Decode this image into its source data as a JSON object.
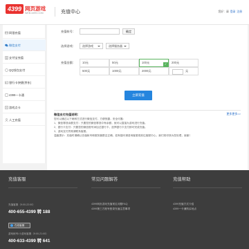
{
  "header": {
    "logo_number": "4399",
    "logo_text": "网页游戏",
    "logo_sub": "WEB.4399.COM",
    "page_title": "充值中心",
    "greeting": "您好：请",
    "login_link": "登录",
    "register_link": "注册"
  },
  "sidebar": {
    "items": [
      {
        "label": "网银充值"
      },
      {
        "label": "微信支付"
      },
      {
        "label": "支付宝充值"
      },
      {
        "label": "QQ钱包支付"
      },
      {
        "label": "银行卡快捷(京东)"
      },
      {
        "label": "4399一卡通"
      },
      {
        "label": "游戏点卡"
      },
      {
        "label": "人工充值"
      }
    ]
  },
  "form": {
    "account_label": "充值帐号：",
    "confirm_button": "确定",
    "game_label": "选择游戏：",
    "game_select": "选择游戏",
    "server_select": "选择服务器",
    "amount_label": "充值金额：",
    "amounts": [
      "10元",
      "50元",
      "100元",
      "200元",
      "500元",
      "1000元",
      "2000元"
    ],
    "selected_amount": "100元",
    "custom_unit": "元",
    "recharge_button": "立即充值"
  },
  "notice": {
    "title": "微信支付充值说明：",
    "more": "更多更多>>",
    "lines": [
      "您可以通过以下两种方式进行微信支付，方便快捷，安全可靠：",
      "1、微信零钱余额支付：只要您的微信零钱中有余额，就可以直接为游戏进行充值。",
      "2、银行卡支付：只要您的微信账号添加过银行卡，选择银行卡支付即可完成充值。",
      "3、游戏支付异常请联系客服。",
      "温馨提示：充值时请确认充值帐号和服务器是否正确，若有疑问请咨询客服或前往客服中心，我们将尽快为您处理，谢谢！"
    ]
  },
  "footer": {
    "service": {
      "title": "充值客服",
      "hours1": "充值客服（9:00-22:00）",
      "phone1": "400-655-4399 转 188",
      "qq_button": "在线客服",
      "hours2": "游戏帐号/小游戏客服（9:00-21:00）",
      "phone2": "400-633-4399 转 641"
    },
    "faq": {
      "title": "常见问题解答",
      "links": [
        "4399网页游戏充值常见问题FAQ",
        "4399第三方账号登录充值注意事项"
      ]
    },
    "help": {
      "title": "充值帮助",
      "links": [
        "4399充值方式介绍",
        "4399一卡通购买地点"
      ]
    }
  },
  "colors": {
    "brand_red": "#e9322f",
    "primary_blue": "#2585de",
    "selected_green": "#5ab45f",
    "footer_bg": "#3d3d3d"
  }
}
